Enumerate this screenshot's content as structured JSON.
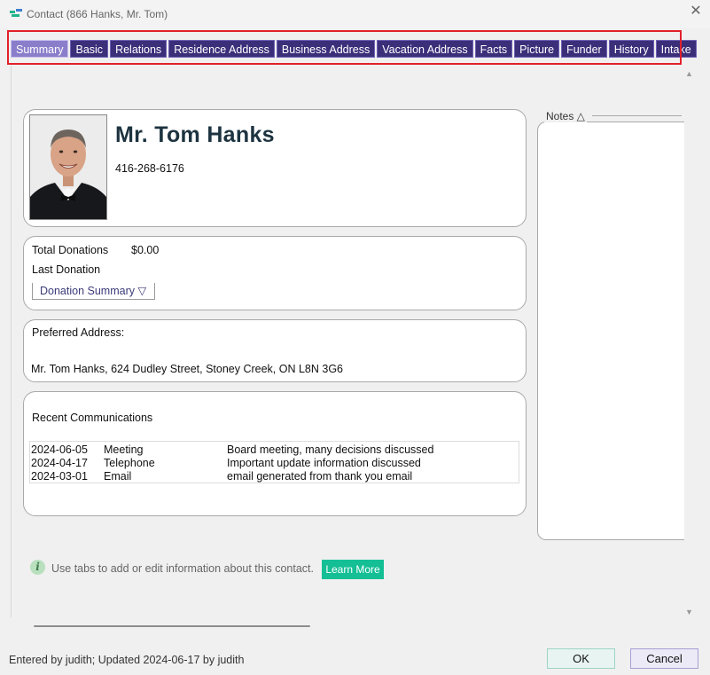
{
  "window": {
    "title": "Contact (866   Hanks, Mr. Tom)",
    "close_icon": "close-icon",
    "app_icon": "app-icon"
  },
  "tabs": [
    {
      "label": "Summary",
      "active": true
    },
    {
      "label": "Basic"
    },
    {
      "label": "Relations"
    },
    {
      "label": "Residence Address"
    },
    {
      "label": "Business Address"
    },
    {
      "label": "Vacation Address"
    },
    {
      "label": "Facts"
    },
    {
      "label": "Picture"
    },
    {
      "label": "Funder"
    },
    {
      "label": "History"
    },
    {
      "label": "Intake"
    }
  ],
  "contact": {
    "name": "Mr. Tom Hanks",
    "phone": "416-268-6176"
  },
  "donations": {
    "total_label": "Total Donations",
    "total_value": "$0.00",
    "last_label": "Last Donation",
    "summary_button": "Donation Summary ▽"
  },
  "address": {
    "label": "Preferred Address:",
    "value": "Mr. Tom Hanks, 624 Dudley Street, Stoney Creek, ON  L8N 3G6"
  },
  "communications": {
    "title": "Recent Communications",
    "rows": [
      {
        "date": "2024-06-05",
        "type": "Meeting",
        "description": "Board meeting, many decisions discussed"
      },
      {
        "date": "2024-04-17",
        "type": "Telephone",
        "description": "Important update information discussed"
      },
      {
        "date": "2024-03-01",
        "type": "Email",
        "description": "email generated from thank you email"
      }
    ]
  },
  "notes": {
    "label": "Notes △"
  },
  "hint": {
    "text": "Use tabs to add or edit information about this contact.",
    "learn_more": "Learn More"
  },
  "footer": {
    "status": "Entered by judith; Updated 2024-06-17 by judith",
    "ok": "OK",
    "cancel": "Cancel"
  },
  "colors": {
    "tab_bg": "#3b2f7a",
    "tab_active_bg": "#8a7ecb",
    "highlight": "#e2202a",
    "learn_more": "#14bf95"
  }
}
